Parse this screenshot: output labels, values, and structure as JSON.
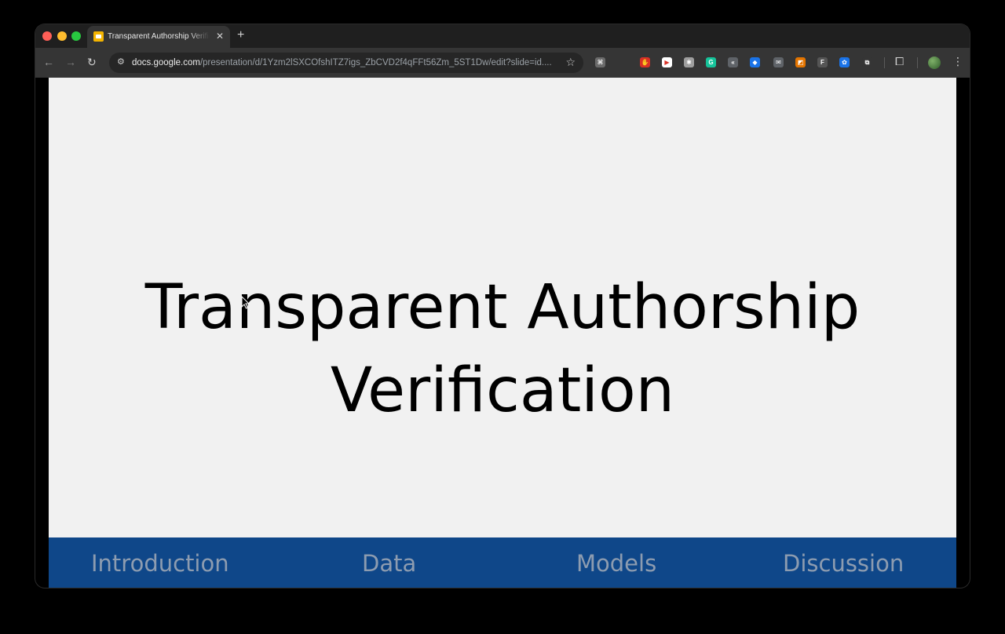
{
  "browser": {
    "tab": {
      "title": "Transparent Authorship Verification"
    },
    "url": {
      "host": "docs.google.com",
      "path": "/presentation/d/1Yzm2lSXCOfshITZ7igs_ZbCVD2f4qFFt56Zm_5ST1Dw/edit?slide=id...."
    },
    "extensions": [
      {
        "name": "ext-1",
        "glyph": "⌘",
        "color": "#6b6b6b"
      },
      {
        "name": "ext-2",
        "glyph": "✋",
        "color": "#d93025"
      },
      {
        "name": "ext-3",
        "glyph": "▶",
        "color": "#ffffff"
      },
      {
        "name": "ext-4",
        "glyph": "✱",
        "color": "#9e9e9e"
      },
      {
        "name": "grammarly-icon",
        "glyph": "G",
        "color": "#15c39a"
      },
      {
        "name": "ext-6",
        "glyph": "«",
        "color": "#5f6368"
      },
      {
        "name": "ext-7",
        "glyph": "◆",
        "color": "#1a73e8"
      },
      {
        "name": "mail-icon",
        "glyph": "✉",
        "color": "#5f6368"
      },
      {
        "name": "ext-9",
        "glyph": "◩",
        "color": "#e37400"
      },
      {
        "name": "ext-10",
        "glyph": "F",
        "color": "#555555"
      },
      {
        "name": "ext-11",
        "glyph": "✿",
        "color": "#1a73e8"
      },
      {
        "name": "extensions-puzzle-icon",
        "glyph": "⧉",
        "color": "#353535"
      }
    ]
  },
  "slide": {
    "title_line1": "Transparent Authorship",
    "title_line2": "Verification",
    "sections": [
      "Introduction",
      "Data",
      "Models",
      "Discussion"
    ]
  },
  "colors": {
    "section_bar": "#0f4789",
    "section_text": "#8d9cb0",
    "slide_bg": "#f1f1f1"
  }
}
